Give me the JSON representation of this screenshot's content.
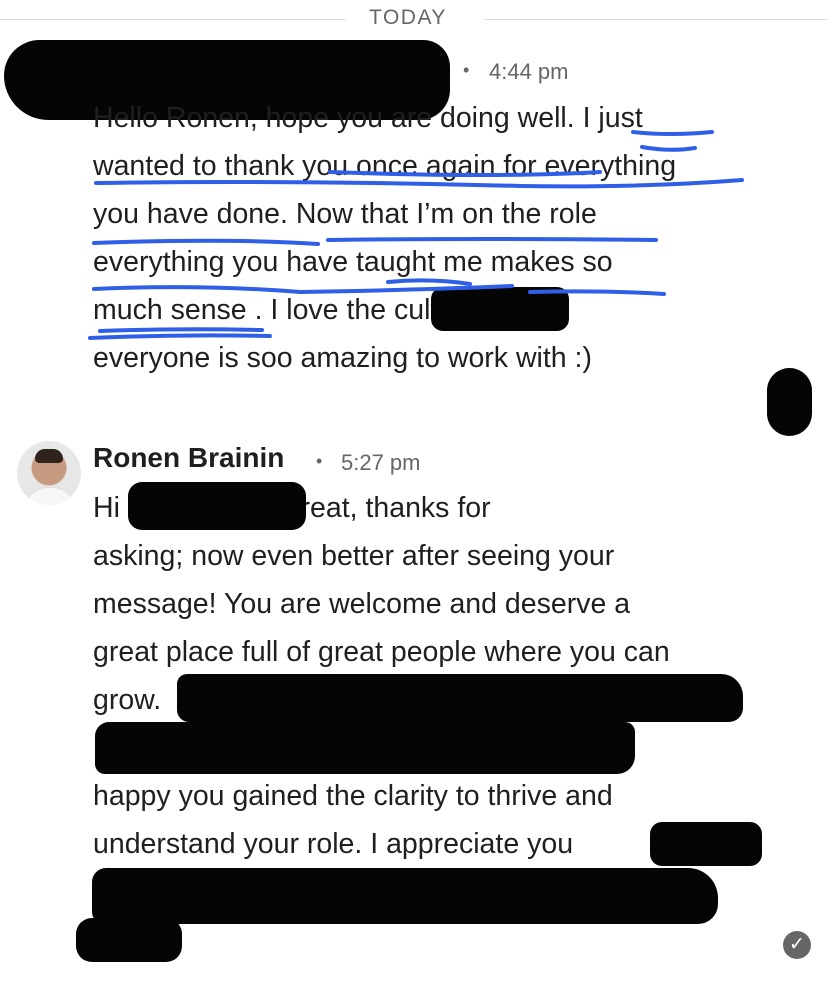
{
  "divider": {
    "label": "TODAY"
  },
  "messages": [
    {
      "sender": "",
      "time": "4:44 pm",
      "body": "Hello Ronen, hope you are doing well. I just\nwanted to thank you once again for everything\nyou have done. Now that I’m on the role\neverything you have taught me makes so\nmuch sense . I love the                        cultures,\neveryone is soo amazing to work with :)"
    },
    {
      "sender": "Ronen Brainin",
      "time": "5:27 pm",
      "body": "Hi                        , I am doing great, thanks for\nasking; now even better after seeing your\nmessage! You are welcome and deserve a\ngreat place full of great people where you can\ngrow.\n                                                                      . I am\nhappy you gained the clarity to thrive and\nunderstand your role. I appreciate you"
    }
  ],
  "icons": {
    "avatar": "avatar-photo",
    "read_receipt": "check-circle-icon"
  },
  "colors": {
    "underline": "#2f5fe6",
    "redaction": "#050505",
    "meta": "#666666"
  }
}
